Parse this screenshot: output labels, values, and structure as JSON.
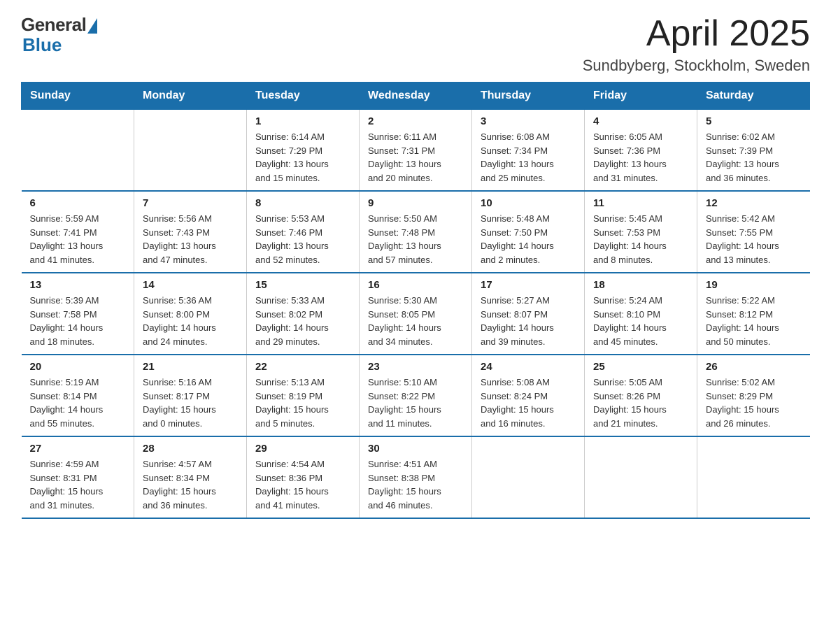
{
  "logo": {
    "text_general": "General",
    "text_blue": "Blue"
  },
  "title": "April 2025",
  "subtitle": "Sundbyberg, Stockholm, Sweden",
  "days_of_week": [
    "Sunday",
    "Monday",
    "Tuesday",
    "Wednesday",
    "Thursday",
    "Friday",
    "Saturday"
  ],
  "weeks": [
    [
      {
        "day": "",
        "info": ""
      },
      {
        "day": "",
        "info": ""
      },
      {
        "day": "1",
        "info": "Sunrise: 6:14 AM\nSunset: 7:29 PM\nDaylight: 13 hours\nand 15 minutes."
      },
      {
        "day": "2",
        "info": "Sunrise: 6:11 AM\nSunset: 7:31 PM\nDaylight: 13 hours\nand 20 minutes."
      },
      {
        "day": "3",
        "info": "Sunrise: 6:08 AM\nSunset: 7:34 PM\nDaylight: 13 hours\nand 25 minutes."
      },
      {
        "day": "4",
        "info": "Sunrise: 6:05 AM\nSunset: 7:36 PM\nDaylight: 13 hours\nand 31 minutes."
      },
      {
        "day": "5",
        "info": "Sunrise: 6:02 AM\nSunset: 7:39 PM\nDaylight: 13 hours\nand 36 minutes."
      }
    ],
    [
      {
        "day": "6",
        "info": "Sunrise: 5:59 AM\nSunset: 7:41 PM\nDaylight: 13 hours\nand 41 minutes."
      },
      {
        "day": "7",
        "info": "Sunrise: 5:56 AM\nSunset: 7:43 PM\nDaylight: 13 hours\nand 47 minutes."
      },
      {
        "day": "8",
        "info": "Sunrise: 5:53 AM\nSunset: 7:46 PM\nDaylight: 13 hours\nand 52 minutes."
      },
      {
        "day": "9",
        "info": "Sunrise: 5:50 AM\nSunset: 7:48 PM\nDaylight: 13 hours\nand 57 minutes."
      },
      {
        "day": "10",
        "info": "Sunrise: 5:48 AM\nSunset: 7:50 PM\nDaylight: 14 hours\nand 2 minutes."
      },
      {
        "day": "11",
        "info": "Sunrise: 5:45 AM\nSunset: 7:53 PM\nDaylight: 14 hours\nand 8 minutes."
      },
      {
        "day": "12",
        "info": "Sunrise: 5:42 AM\nSunset: 7:55 PM\nDaylight: 14 hours\nand 13 minutes."
      }
    ],
    [
      {
        "day": "13",
        "info": "Sunrise: 5:39 AM\nSunset: 7:58 PM\nDaylight: 14 hours\nand 18 minutes."
      },
      {
        "day": "14",
        "info": "Sunrise: 5:36 AM\nSunset: 8:00 PM\nDaylight: 14 hours\nand 24 minutes."
      },
      {
        "day": "15",
        "info": "Sunrise: 5:33 AM\nSunset: 8:02 PM\nDaylight: 14 hours\nand 29 minutes."
      },
      {
        "day": "16",
        "info": "Sunrise: 5:30 AM\nSunset: 8:05 PM\nDaylight: 14 hours\nand 34 minutes."
      },
      {
        "day": "17",
        "info": "Sunrise: 5:27 AM\nSunset: 8:07 PM\nDaylight: 14 hours\nand 39 minutes."
      },
      {
        "day": "18",
        "info": "Sunrise: 5:24 AM\nSunset: 8:10 PM\nDaylight: 14 hours\nand 45 minutes."
      },
      {
        "day": "19",
        "info": "Sunrise: 5:22 AM\nSunset: 8:12 PM\nDaylight: 14 hours\nand 50 minutes."
      }
    ],
    [
      {
        "day": "20",
        "info": "Sunrise: 5:19 AM\nSunset: 8:14 PM\nDaylight: 14 hours\nand 55 minutes."
      },
      {
        "day": "21",
        "info": "Sunrise: 5:16 AM\nSunset: 8:17 PM\nDaylight: 15 hours\nand 0 minutes."
      },
      {
        "day": "22",
        "info": "Sunrise: 5:13 AM\nSunset: 8:19 PM\nDaylight: 15 hours\nand 5 minutes."
      },
      {
        "day": "23",
        "info": "Sunrise: 5:10 AM\nSunset: 8:22 PM\nDaylight: 15 hours\nand 11 minutes."
      },
      {
        "day": "24",
        "info": "Sunrise: 5:08 AM\nSunset: 8:24 PM\nDaylight: 15 hours\nand 16 minutes."
      },
      {
        "day": "25",
        "info": "Sunrise: 5:05 AM\nSunset: 8:26 PM\nDaylight: 15 hours\nand 21 minutes."
      },
      {
        "day": "26",
        "info": "Sunrise: 5:02 AM\nSunset: 8:29 PM\nDaylight: 15 hours\nand 26 minutes."
      }
    ],
    [
      {
        "day": "27",
        "info": "Sunrise: 4:59 AM\nSunset: 8:31 PM\nDaylight: 15 hours\nand 31 minutes."
      },
      {
        "day": "28",
        "info": "Sunrise: 4:57 AM\nSunset: 8:34 PM\nDaylight: 15 hours\nand 36 minutes."
      },
      {
        "day": "29",
        "info": "Sunrise: 4:54 AM\nSunset: 8:36 PM\nDaylight: 15 hours\nand 41 minutes."
      },
      {
        "day": "30",
        "info": "Sunrise: 4:51 AM\nSunset: 8:38 PM\nDaylight: 15 hours\nand 46 minutes."
      },
      {
        "day": "",
        "info": ""
      },
      {
        "day": "",
        "info": ""
      },
      {
        "day": "",
        "info": ""
      }
    ]
  ]
}
